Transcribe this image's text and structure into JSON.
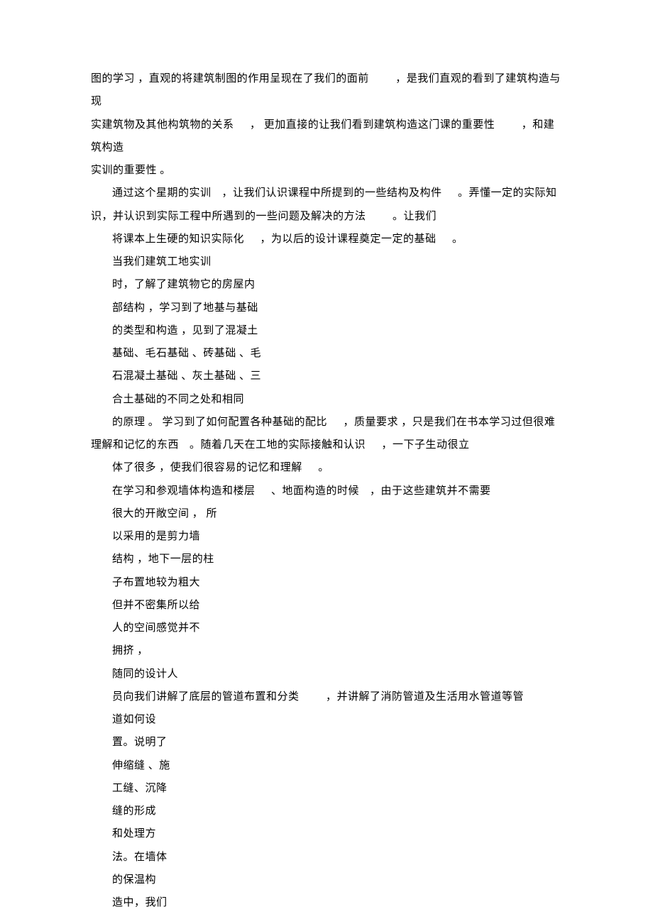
{
  "lines": {
    "l1a": "图的学习 ，直观的将建筑制图的作用呈现在了我们的面前",
    "l1b": "，是我们直观的看到了建筑构造与现",
    "l2a": "实建筑物及其他构筑物的关系",
    "l2b": "， 更加直接的让我们看到建筑构造这门课的重要性",
    "l2c": "，和建筑构造",
    "l3": "实训的重要性 。",
    "l4a": "通过这个星期的实训",
    "l4b": "，让我们认识课程中所提到的一些结构及构件",
    "l4c": "。弄懂一定的实际知",
    "l5a": "识，并认识到实际工程中所遇到的一些问题及解决的方法",
    "l5b": "。让我们",
    "l6a": "将课本上生硬的知识实际化",
    "l6b": "，为以后的设计课程奠定一定的基础",
    "l6c": "。",
    "l7": "当我们建筑工地实训",
    "l8": "时，了解了建筑物它的房屋内",
    "l9": "部结构 ，学习到了地基与基础",
    "l10": "的类型和构造 ，见到了混凝土",
    "l11": "基础、毛石基础 、砖基础 、毛",
    "l12": "石混凝土基础 、灰土基础 、三",
    "l13": "合土基础的不同之处和相同",
    "l14a": "的原理 。 学习到了如何配置各种基础的配比",
    "l14b": "，质量要求 ，只是我们在书本学习过但很难",
    "l15a": "理解和记忆的东西",
    "l15b": "。随着几天在工地的实际接触和认识",
    "l15c": "，一下子生动很立",
    "l16a": "体了很多 ，使我们很容易的记忆和理解",
    "l16b": "。",
    "l17a": "在学习和参观墙体构造和楼层",
    "l17b": "、地面构造的时候",
    "l17c": "，由于这些建筑并不需要",
    "l18": "很大的开敞空间 ， 所",
    "l19": "以采用的是剪力墙",
    "l20": "结构 ，地下一层的柱",
    "l21": "子布置地较为粗大",
    "l22": "但并不密集所以给",
    "l23": "人的空间感觉并不",
    "l24": "拥挤 ，",
    "l25": "随同的设计人",
    "l26a": "员向我们讲解了底层的管道布置和分类",
    "l26b": "，并讲解了消防管道及生活用水管道等管",
    "l27": "道如何设",
    "l28": "置。说明了",
    "l29": "伸缩缝 、施",
    "l30": "工缝、沉降",
    "l31": "缝的形成",
    "l32": "和处理方",
    "l33": "法。在墙体",
    "l34": "的保温构",
    "l35": "造中，我们"
  }
}
